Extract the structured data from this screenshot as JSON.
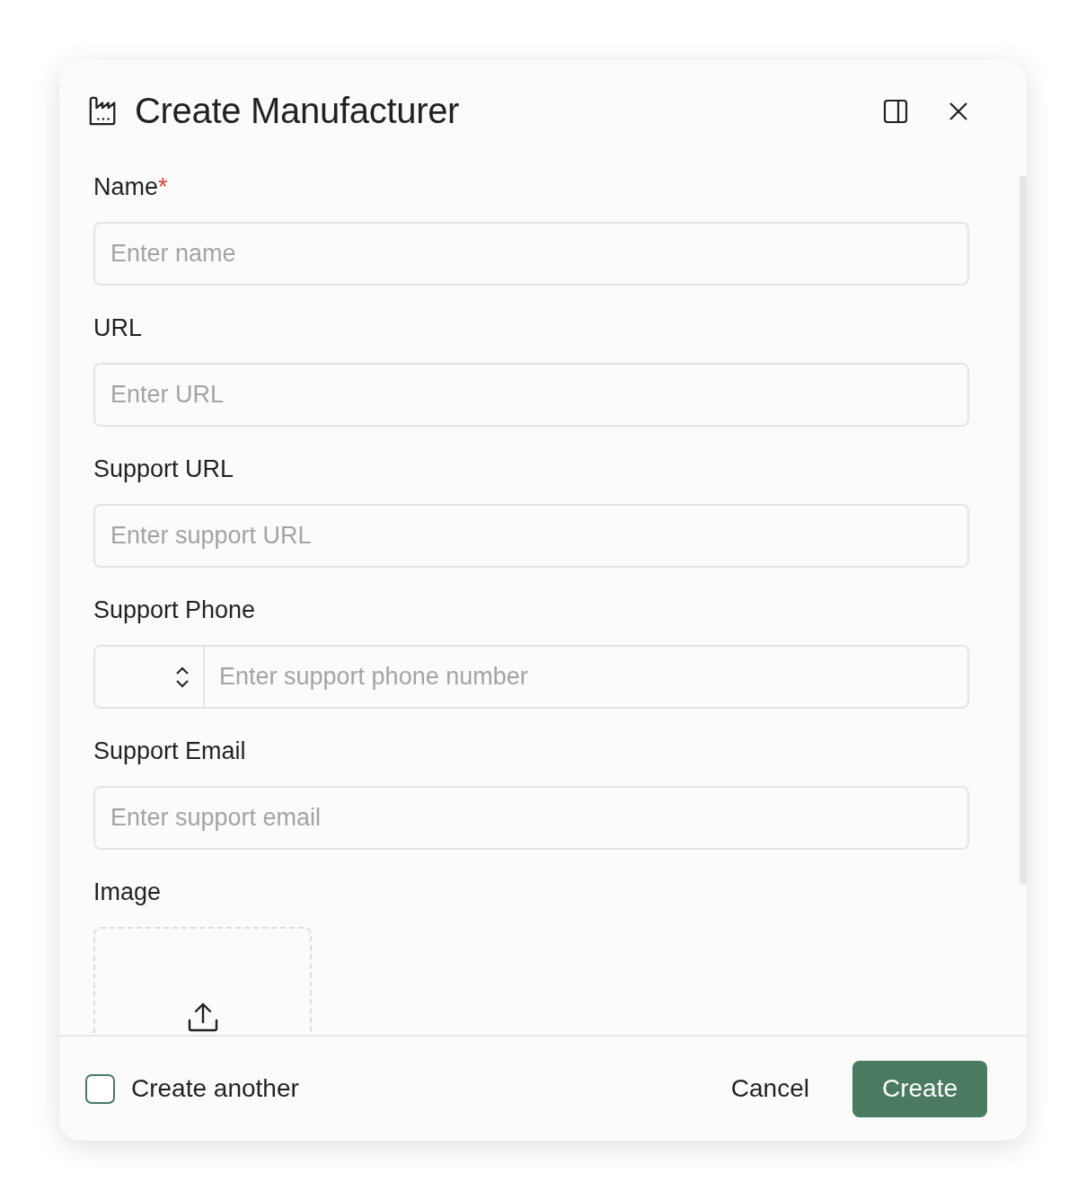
{
  "dialog": {
    "title": "Create Manufacturer"
  },
  "fields": [
    {
      "kind": "text",
      "label": "Name",
      "required": true,
      "placeholder": "Enter name"
    },
    {
      "kind": "text",
      "label": "URL",
      "required": false,
      "placeholder": "Enter URL"
    },
    {
      "kind": "text",
      "label": "Support URL",
      "required": false,
      "placeholder": "Enter support URL"
    },
    {
      "kind": "phone",
      "label": "Support Phone",
      "required": false,
      "placeholder": "Enter support phone number"
    },
    {
      "kind": "text",
      "label": "Support Email",
      "required": false,
      "placeholder": "Enter support email"
    },
    {
      "kind": "upload",
      "label": "Image",
      "required": false
    }
  ],
  "required_mark": "*",
  "footer": {
    "create_another": {
      "label": "Create another",
      "checked": false
    },
    "buttons": [
      {
        "kind": "secondary",
        "label": "Cancel"
      },
      {
        "kind": "primary",
        "label": "Create"
      }
    ]
  }
}
